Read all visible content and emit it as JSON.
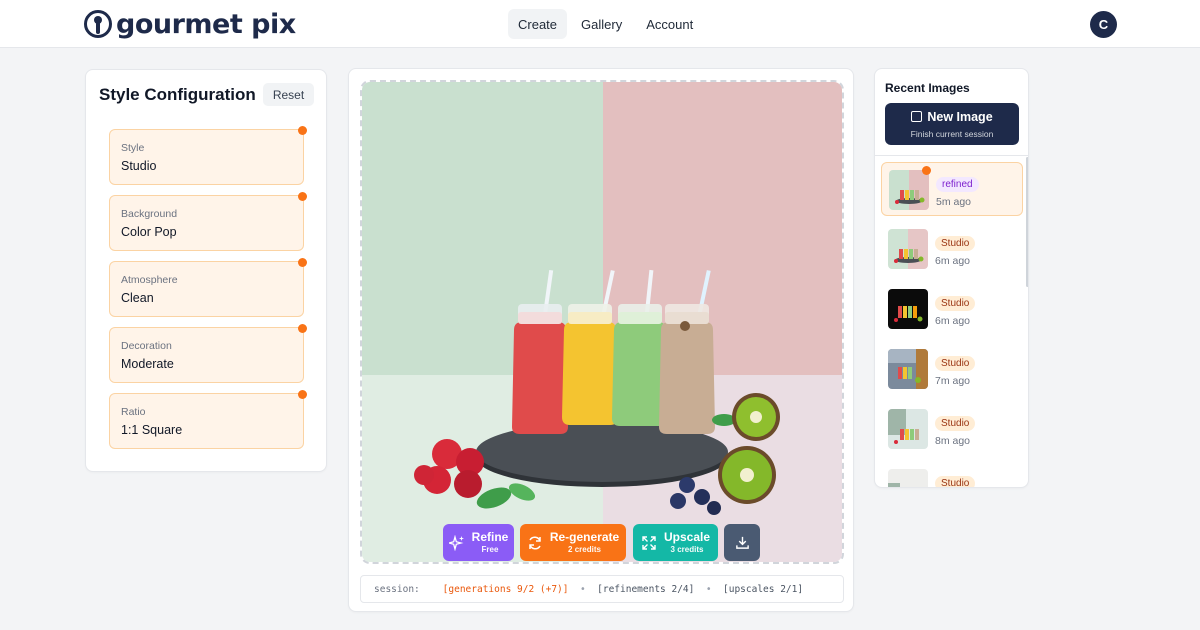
{
  "app": {
    "name": "gourmet pix",
    "user_initial": "C"
  },
  "nav": {
    "items": [
      "Create",
      "Gallery",
      "Account"
    ],
    "active": "Create"
  },
  "style_config": {
    "title": "Style Configuration",
    "reset_label": "Reset",
    "fields": [
      {
        "label": "Style",
        "value": "Studio",
        "modified": true
      },
      {
        "label": "Background",
        "value": "Color Pop",
        "modified": true
      },
      {
        "label": "Atmosphere",
        "value": "Clean",
        "modified": true
      },
      {
        "label": "Decoration",
        "value": "Moderate",
        "modified": true
      },
      {
        "label": "Ratio",
        "value": "1:1 Square",
        "modified": true
      }
    ]
  },
  "canvas": {
    "image_icon": "smoothie-bottles-photo",
    "actions": [
      {
        "title": "Refine",
        "sub": "Free",
        "icon": "sparkles-icon",
        "color": "#8b5cf6"
      },
      {
        "title": "Re-generate",
        "sub": "2 credits",
        "icon": "refresh-icon",
        "color": "#f97316"
      },
      {
        "title": "Upscale",
        "sub": "3 credits",
        "icon": "expand-icon",
        "color": "#14b8a6"
      },
      {
        "title": "",
        "sub": "",
        "icon": "download-icon",
        "color": "#4a5a72"
      }
    ],
    "session": {
      "prefix": "session:",
      "generations": "[generations 9/2 (+7)]",
      "separator": "•",
      "refinements": "[refinements 2/4]",
      "upscales": "[upscales 2/1]"
    }
  },
  "recent": {
    "title": "Recent Images",
    "new_image": {
      "title": "New Image",
      "sub": "Finish current session",
      "icon": "exit-icon"
    },
    "items": [
      {
        "tag": "refined",
        "time": "5m ago",
        "selected": true
      },
      {
        "tag": "Studio",
        "time": "6m ago",
        "selected": false
      },
      {
        "tag": "Studio",
        "time": "6m ago",
        "selected": false
      },
      {
        "tag": "Studio",
        "time": "7m ago",
        "selected": false
      },
      {
        "tag": "Studio",
        "time": "8m ago",
        "selected": false
      },
      {
        "tag": "Studio",
        "time": "",
        "selected": false
      }
    ]
  },
  "colors": {
    "brand_navy": "#1e2a4a",
    "accent_orange": "#f97316",
    "field_bg": "#fff4e9",
    "field_border": "#fbd3a3"
  }
}
